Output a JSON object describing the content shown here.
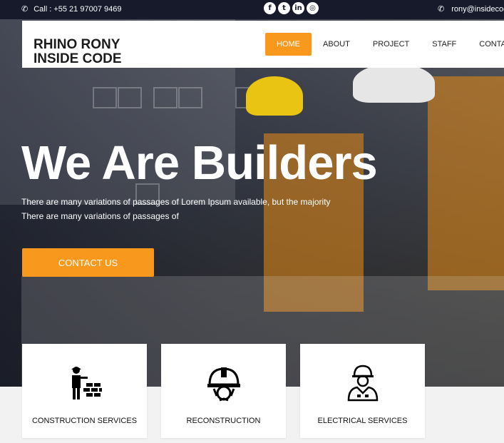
{
  "topbar": {
    "phone_icon": "phone-icon",
    "phone": "Call : +55 21 97007 9469",
    "email": "rony@insidecode",
    "socials": [
      {
        "icon": "facebook-icon",
        "glyph": "f"
      },
      {
        "icon": "twitter-icon",
        "glyph": "t"
      },
      {
        "icon": "linkedin-icon",
        "glyph": "in"
      },
      {
        "icon": "instagram-icon",
        "glyph": "◎"
      }
    ]
  },
  "header": {
    "logo_line1": "RHINO RONY",
    "logo_line2": "INSIDE CODE",
    "nav": [
      "HOME",
      "ABOUT",
      "PROJECT",
      "STAFF",
      "CONTACT"
    ]
  },
  "hero": {
    "title": "We Are Builders",
    "text1": "There are many variations of passages of Lorem Ipsum available, but the majority",
    "text2": "There are many variations of passages of",
    "cta": "CONTACT US"
  },
  "services": [
    {
      "label": "CONSTRUCTION SERVICES",
      "icon": "worker-bricks-icon"
    },
    {
      "label": "RECONSTRUCTION",
      "icon": "helmet-gear-icon"
    },
    {
      "label": "ELECTRICAL SERVICES",
      "icon": "engineer-icon"
    }
  ],
  "colors": {
    "accent": "#f8991d",
    "topbar": "#161a2b"
  }
}
